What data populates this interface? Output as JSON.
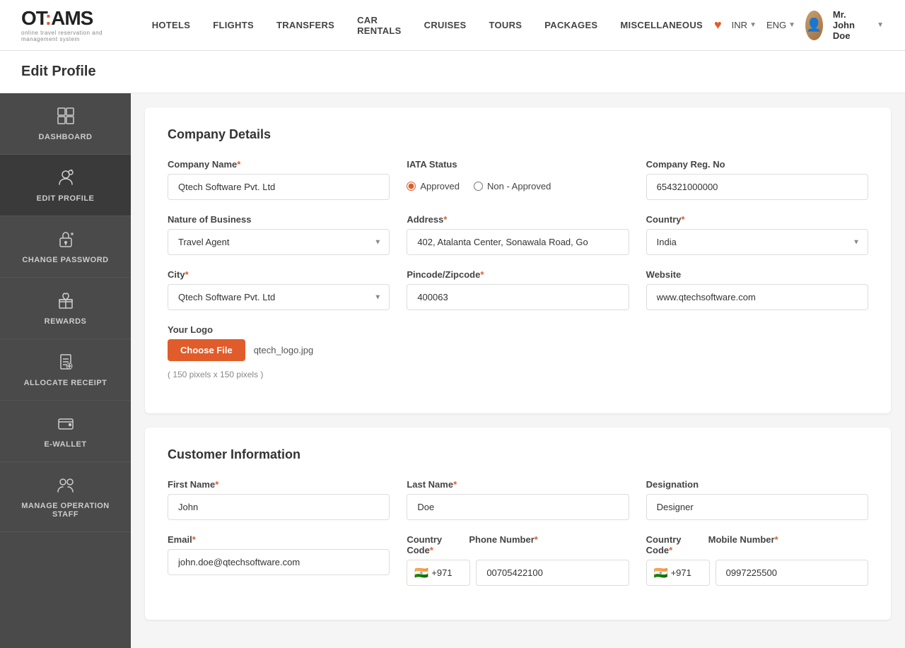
{
  "brand": {
    "name": "OT:AMS",
    "tagline": "online travel reservation and management system"
  },
  "nav": {
    "items": [
      {
        "label": "HOTELS",
        "name": "hotels"
      },
      {
        "label": "FLIGHTS",
        "name": "flights"
      },
      {
        "label": "TRANSFERS",
        "name": "transfers"
      },
      {
        "label": "CAR RENTALS",
        "name": "car-rentals"
      },
      {
        "label": "CRUISES",
        "name": "cruises"
      },
      {
        "label": "TOURS",
        "name": "tours"
      },
      {
        "label": "PACKAGES",
        "name": "packages"
      },
      {
        "label": "MISCELLANEOUS",
        "name": "miscellaneous"
      }
    ]
  },
  "header": {
    "currency": "INR",
    "language": "ENG",
    "user_name": "Mr. John Doe"
  },
  "page": {
    "title": "Edit Profile"
  },
  "sidebar": {
    "items": [
      {
        "label": "DASHBOARD",
        "icon": "dashboard"
      },
      {
        "label": "EDIT PROFILE",
        "icon": "edit-profile",
        "active": true
      },
      {
        "label": "CHANGE PASSWORD",
        "icon": "change-password"
      },
      {
        "label": "REWARDS",
        "icon": "rewards"
      },
      {
        "label": "ALLOCATE RECEIPT",
        "icon": "allocate-receipt"
      },
      {
        "label": "E-WALLET",
        "icon": "e-wallet"
      },
      {
        "label": "MANAGE OPERATION STAFF",
        "icon": "manage-staff"
      }
    ]
  },
  "company_details": {
    "section_title": "Company Details",
    "company_name_label": "Company Name",
    "company_name_value": "Qtech Software Pvt. Ltd",
    "iata_status_label": "IATA Status",
    "iata_approved_label": "Approved",
    "iata_non_approved_label": "Non - Approved",
    "company_reg_no_label": "Company Reg. No",
    "company_reg_no_value": "654321000000",
    "nature_of_business_label": "Nature of Business",
    "nature_of_business_value": "Travel Agent",
    "address_label": "Address",
    "address_value": "402, Atalanta Center, Sonawala Road, Go",
    "country_label": "Country",
    "country_value": "India",
    "city_label": "City",
    "city_value": "Qtech Software Pvt. Ltd",
    "pincode_label": "Pincode/Zipcode",
    "pincode_value": "400063",
    "website_label": "Website",
    "website_value": "www.qtechsoftware.com",
    "your_logo_label": "Your Logo",
    "choose_file_label": "Choose File",
    "file_name": "qtech_logo.jpg",
    "file_hint": "( 150 pixels x 150 pixels )"
  },
  "customer_information": {
    "section_title": "Customer Information",
    "first_name_label": "First Name",
    "first_name_value": "John",
    "last_name_label": "Last Name",
    "last_name_value": "Doe",
    "designation_label": "Designation",
    "designation_value": "Designer",
    "email_label": "Email",
    "email_value": "john.doe@qtechsoftware.com",
    "country_code_label": "Country Code",
    "country_code_value": "+971",
    "phone_number_label": "Phone Number",
    "phone_number_value": "00705422100",
    "mobile_country_code_label": "Country Code",
    "mobile_country_code_value": "+971",
    "mobile_number_label": "Mobile Number",
    "mobile_number_value": "0997225500"
  }
}
